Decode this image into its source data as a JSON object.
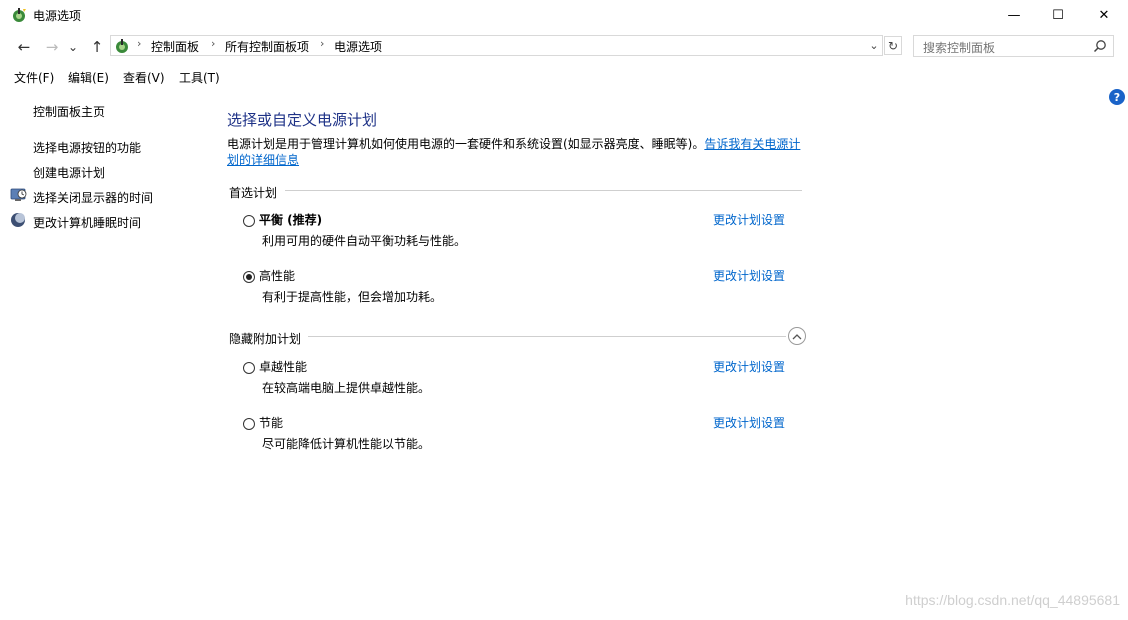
{
  "window": {
    "title": "电源选项",
    "minimize_glyph": "—",
    "maximize_glyph": "☐",
    "close_glyph": "✕"
  },
  "nav": {
    "back_glyph": "←",
    "forward_glyph": "→",
    "recent_glyph": "⌄",
    "up_glyph": "↑",
    "breadcrumbs": [
      "控制面板",
      "所有控制面板项",
      "电源选项"
    ],
    "breadcrumb_separator": "›",
    "search_placeholder": "搜索控制面板"
  },
  "menu": {
    "items": [
      "文件(F)",
      "编辑(E)",
      "查看(V)",
      "工具(T)"
    ]
  },
  "sidebar": {
    "home": "控制面板主页",
    "links": [
      {
        "label": "选择电源按钮的功能",
        "icon": "none"
      },
      {
        "label": "创建电源计划",
        "icon": "none"
      },
      {
        "label": "选择关闭显示器的时间",
        "icon": "monitor-clock-icon"
      },
      {
        "label": "更改计算机睡眠时间",
        "icon": "moon-icon"
      }
    ]
  },
  "main": {
    "heading": "选择或自定义电源计划",
    "description": "电源计划是用于管理计算机如何使用电源的一套硬件和系统设置(如显示器亮度、睡眠等)。",
    "description_link": "告诉我有关电源计划的详细信息",
    "preferred_section": "首选计划",
    "hidden_section": "隐藏附加计划",
    "change_link": "更改计划设置",
    "plans": [
      {
        "name": "平衡 (推荐)",
        "desc": "利用可用的硬件自动平衡功耗与性能。",
        "selected": false,
        "bold": true
      },
      {
        "name": "高性能",
        "desc": "有利于提高性能，但会增加功耗。",
        "selected": true,
        "bold": false
      },
      {
        "name": "卓越性能",
        "desc": "在较高端电脑上提供卓越性能。",
        "selected": false,
        "bold": false
      },
      {
        "name": "节能",
        "desc": "尽可能降低计算机性能以节能。",
        "selected": false,
        "bold": false
      }
    ],
    "help_glyph": "?"
  },
  "watermark": "https://blog.csdn.net/qq_44895681",
  "colors": {
    "heading": "#1e3287",
    "link": "#0066cc",
    "help": "#1a63c8"
  }
}
